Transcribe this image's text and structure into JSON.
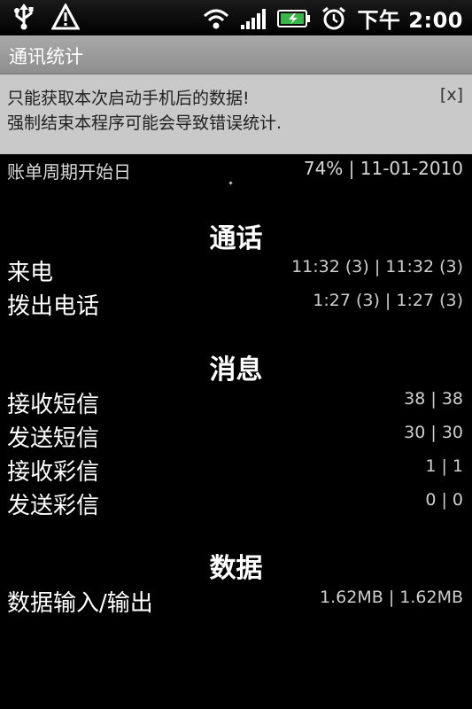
{
  "status_bar": {
    "time": "下午 2:00",
    "icons": [
      "usb-icon",
      "warning-icon",
      "wifi-icon",
      "signal-icon",
      "battery-icon",
      "alarm-icon"
    ]
  },
  "app": {
    "title": "通讯统计"
  },
  "banner": {
    "line1": "只能获取本次启动手机后的数据!",
    "line2": "强制结束本程序可能会导致错误统计.",
    "close_label": "[x]"
  },
  "billing": {
    "label": "账单周期开始日",
    "value": "74%  |  11-01-2010"
  },
  "calls": {
    "heading": "通话",
    "items": [
      {
        "label": "来电",
        "value": "11:32 (3) | 11:32 (3)"
      },
      {
        "label": "拨出电话",
        "value": "1:27 (3) | 1:27 (3)"
      }
    ]
  },
  "messages": {
    "heading": "消息",
    "items": [
      {
        "label": "接收短信",
        "value": "38 | 38"
      },
      {
        "label": "发送短信",
        "value": "30 | 30"
      },
      {
        "label": "接收彩信",
        "value": "1 | 1"
      },
      {
        "label": "发送彩信",
        "value": "0 | 0"
      }
    ]
  },
  "data": {
    "heading": "数据",
    "items": [
      {
        "label": "数据输入/输出",
        "value": "1.62MB | 1.62MB"
      }
    ]
  },
  "colors": {
    "background": "#000000",
    "titlebar": "#9a9a9a",
    "banner": "#c9c9c9",
    "battery": "#39b54a"
  }
}
